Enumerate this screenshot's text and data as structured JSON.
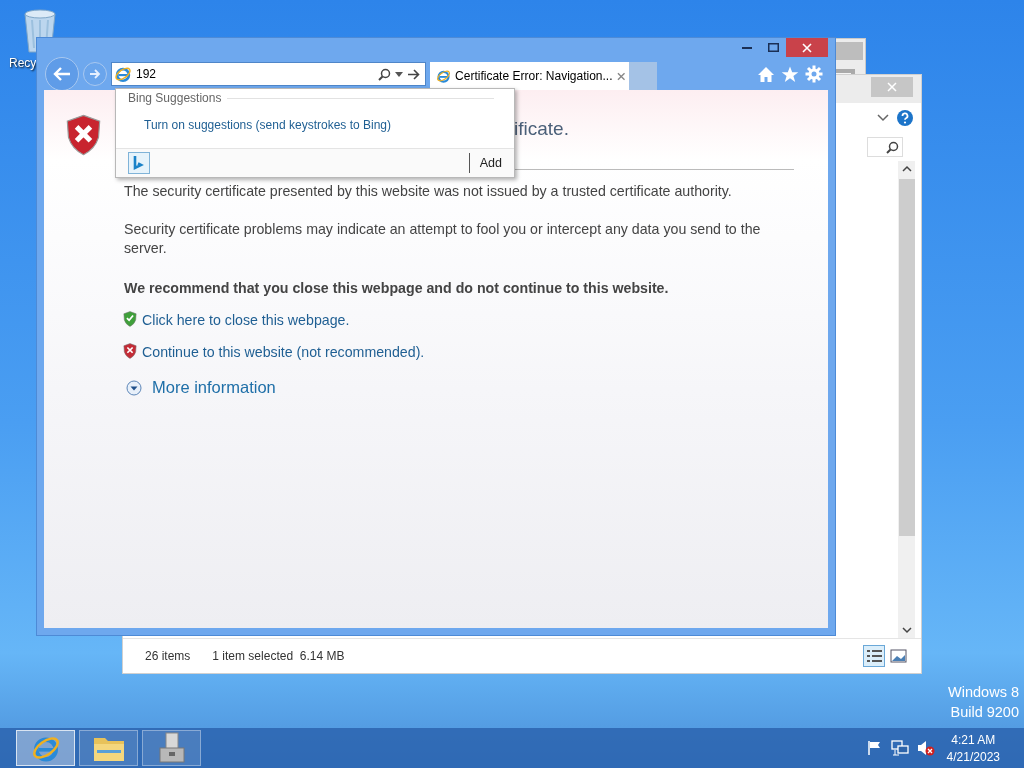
{
  "desktop": {
    "icons": [
      {
        "label": "Recy"
      }
    ],
    "watermark": [
      "Windows 8",
      "Build 9200"
    ]
  },
  "explorer_window": {
    "status_bar": {
      "item_count": "26 items",
      "selection": "1 item selected  6.14 MB"
    },
    "views": [
      {
        "kind": "details",
        "selected": true
      },
      {
        "kind": "thumbnails",
        "selected": false
      }
    ]
  },
  "browser": {
    "address_bar": {
      "value": "192"
    },
    "tabs": [
      {
        "title": "Certificate Error: Navigation...",
        "selected": true
      }
    ],
    "suggestions": {
      "header": "Bing Suggestions",
      "link": "Turn on suggestions (send keystrokes to Bing)",
      "button": "Add"
    },
    "page": {
      "heading": "ificate.",
      "paragraphs": [
        "The security certificate presented by this website was not issued by a trusted certificate authority.",
        "Security certificate problems may indicate an attempt to fool you or intercept any data you send to the server."
      ],
      "warning": "We recommend that you close this webpage and do not continue to this website.",
      "actions": [
        {
          "kind": "safe",
          "text": "Click here to close this webpage."
        },
        {
          "kind": "unsafe",
          "text": "Continue to this website (not recommended)."
        }
      ],
      "more_info": "More information"
    }
  },
  "taskbar": {
    "apps": [
      {
        "kind": "browser",
        "selected": true
      },
      {
        "kind": "files",
        "selected": false
      },
      {
        "kind": "server",
        "selected": false
      }
    ],
    "clock": {
      "time": "4:21 AM",
      "date": "4/21/2023"
    }
  }
}
